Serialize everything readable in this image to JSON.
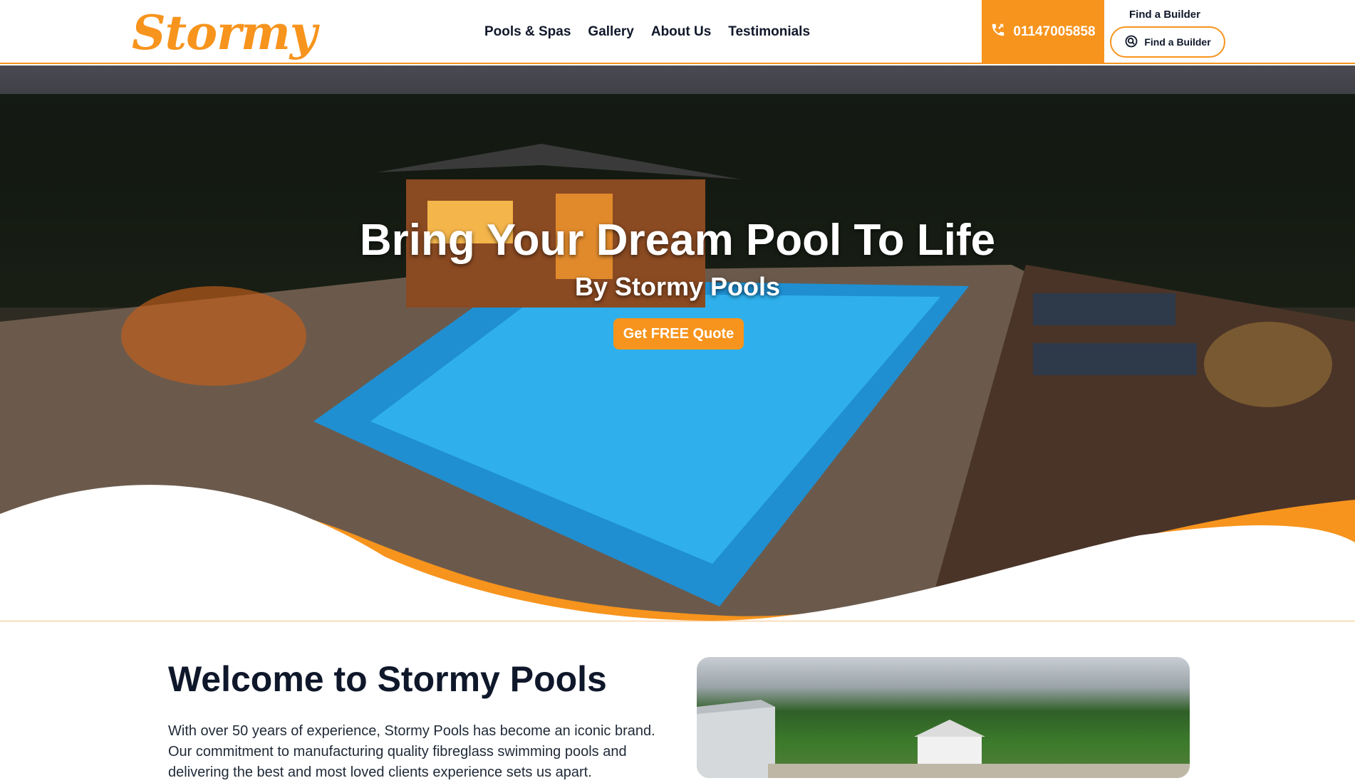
{
  "brand": {
    "logo_text": "Stormy",
    "accent": "#f7941d",
    "dark": "#0f172a"
  },
  "nav": {
    "items": [
      "Pools & Spas",
      "Gallery",
      "About Us",
      "Testimonials"
    ]
  },
  "header": {
    "phone": "01147005858",
    "find_label": "Find a Builder",
    "find_button": "Find a Builder"
  },
  "hero": {
    "title": "Bring Your Dream Pool To Life",
    "subtitle": "By Stormy Pools",
    "cta": "Get FREE Quote"
  },
  "welcome": {
    "title": "Welcome to Stormy Pools",
    "text": "With over 50 years of experience, Stormy Pools has become an iconic brand. Our commitment to manufacturing quality fibreglass swimming pools and delivering the best and most loved clients experience sets us apart."
  },
  "icons": {
    "phone": "phone-icon",
    "search": "search-icon"
  }
}
